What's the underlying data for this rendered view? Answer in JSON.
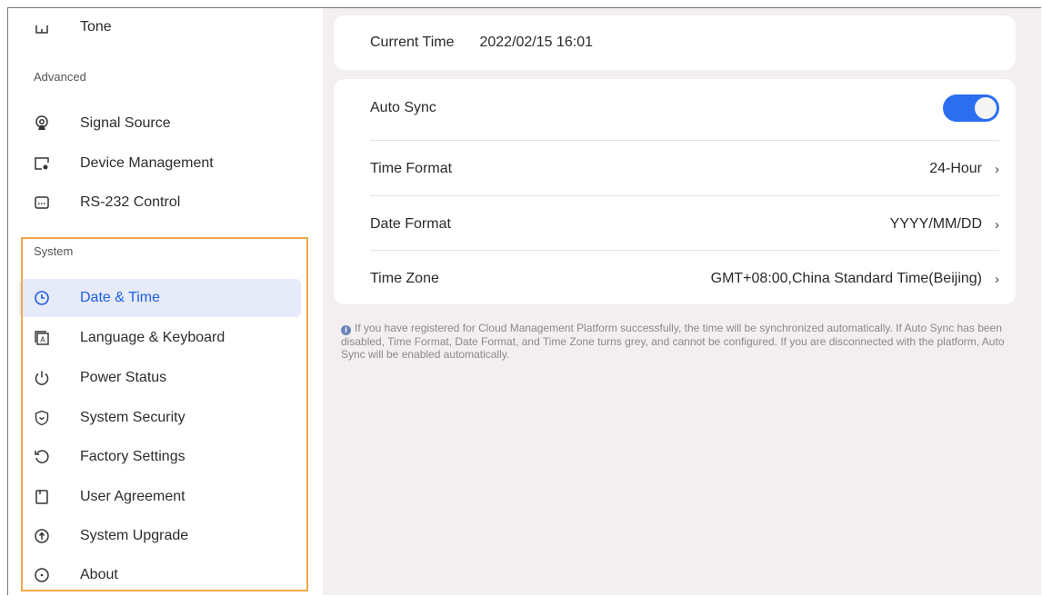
{
  "sidebar": {
    "top_item": {
      "label": "Tone",
      "icon": "tone-icon"
    },
    "advanced_header": "Advanced",
    "advanced_items": [
      {
        "label": "Signal Source",
        "icon": "signal-source-icon"
      },
      {
        "label": "Device Management",
        "icon": "device-management-icon"
      },
      {
        "label": "RS-232 Control",
        "icon": "rs232-icon"
      }
    ],
    "system_header": "System",
    "system_items": [
      {
        "label": "Date & Time",
        "icon": "clock-icon",
        "active": true
      },
      {
        "label": "Language & Keyboard",
        "icon": "keyboard-icon"
      },
      {
        "label": "Power Status",
        "icon": "power-icon"
      },
      {
        "label": "System Security",
        "icon": "shield-icon"
      },
      {
        "label": "Factory Settings",
        "icon": "reset-icon"
      },
      {
        "label": "User Agreement",
        "icon": "document-icon"
      },
      {
        "label": "System Upgrade",
        "icon": "upgrade-icon"
      },
      {
        "label": "About",
        "icon": "info-icon"
      }
    ]
  },
  "main": {
    "current_time": {
      "label": "Current Time",
      "value": "2022/02/15 16:01"
    },
    "auto_sync": {
      "label": "Auto Sync",
      "enabled": true
    },
    "time_format": {
      "label": "Time Format",
      "value": "24-Hour"
    },
    "date_format": {
      "label": "Date Format",
      "value": "YYYY/MM/DD"
    },
    "time_zone": {
      "label": "Time Zone",
      "value": "GMT+08:00,China Standard Time(Beijing)"
    },
    "note": "If you have registered for Cloud Management Platform successfully, the time will be synchronized automatically. If Auto Sync has been disabled, Time Format, Date Format, and Time Zone turns grey, and cannot be configured. If you are disconnected with the platform, Auto Sync will be enabled automatically."
  },
  "colors": {
    "accent": "#2b6ff0",
    "active_bg": "#e6eaf9",
    "highlight_border": "#f0a94a",
    "main_bg": "#f3eef0"
  }
}
